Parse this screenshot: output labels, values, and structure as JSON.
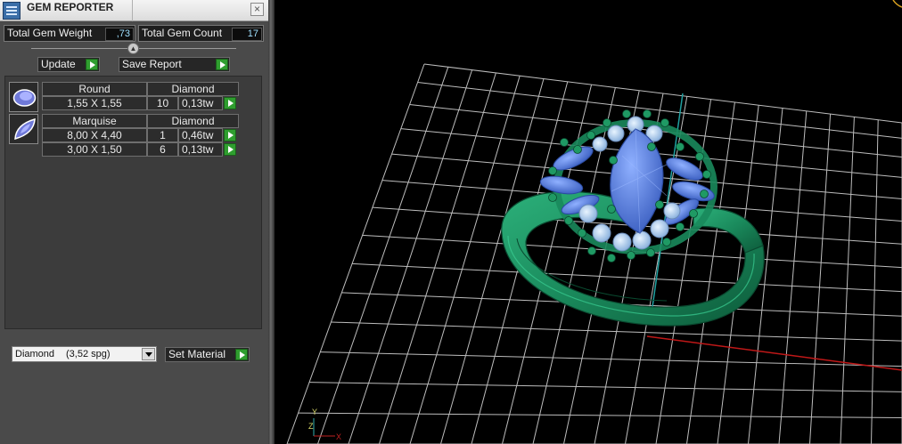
{
  "window": {
    "title": "GEM REPORTER",
    "close_glyph": "×",
    "app_icon": "report-icon"
  },
  "stats": {
    "total_weight_label": "Total Gem Weight",
    "total_weight_value": ",73",
    "total_count_label": "Total Gem Count",
    "total_count_value": "17"
  },
  "buttons": {
    "update": "Update",
    "save_report": "Save Report",
    "set_material": "Set Material"
  },
  "gems": [
    {
      "cut": "Round",
      "material": "Diamond",
      "icon": "round-gem-icon",
      "rows": [
        {
          "size": "1,55 X 1,55",
          "count": "10",
          "weight": "0,13tw"
        }
      ]
    },
    {
      "cut": "Marquise",
      "material": "Diamond",
      "icon": "marquise-gem-icon",
      "rows": [
        {
          "size": "8,00 X 4,40",
          "count": "1",
          "weight": "0,46tw"
        },
        {
          "size": "3,00 X 1,50",
          "count": "6",
          "weight": "0,13tw"
        }
      ]
    }
  ],
  "material_dropdown": {
    "name": "Diamond",
    "spg": "(3,52 spg)"
  },
  "axes": {
    "x": "X",
    "y": "Y",
    "z": "Z"
  },
  "colors": {
    "panel_bg": "#4a4a4a",
    "ring_green": "#1f8a5e",
    "gem_blue": "#5b82d8",
    "grid": "#c8c8c8",
    "axis_y": "#1fa0a0",
    "axis_x": "#c01818",
    "accent_green": "#2f9e2f"
  }
}
